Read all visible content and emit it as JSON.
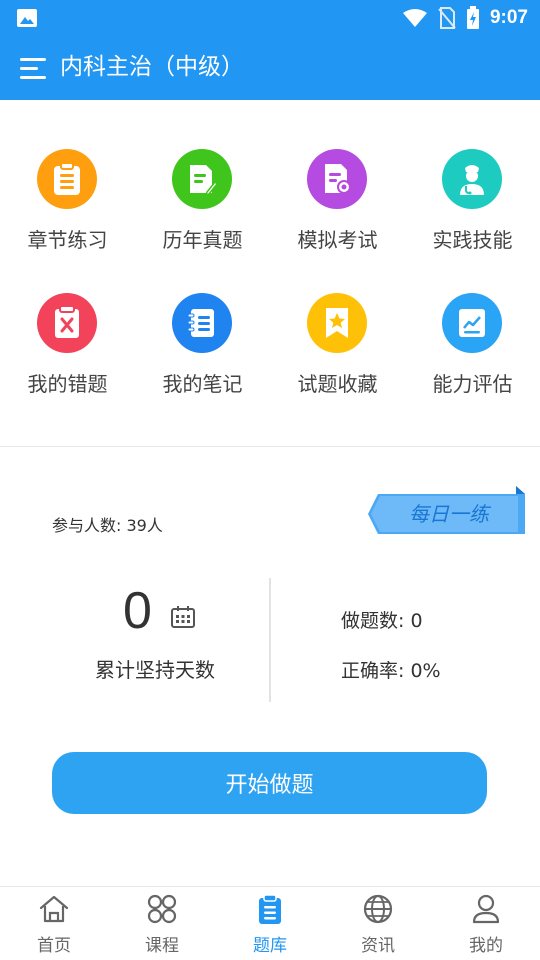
{
  "status_bar": {
    "time": "9:07",
    "icons": [
      "image-notification-icon",
      "wifi-icon",
      "no-sim-icon",
      "battery-charging-icon"
    ]
  },
  "header": {
    "title": "内科主治（中级）",
    "menu_icon": "menu-icon"
  },
  "features": [
    {
      "label": "章节练习",
      "icon": "clipboard-list-icon",
      "color": "#ff9f0f"
    },
    {
      "label": "历年真题",
      "icon": "document-edit-icon",
      "color": "#3fc51c"
    },
    {
      "label": "模拟考试",
      "icon": "certificate-document-icon",
      "color": "#b54be0"
    },
    {
      "label": "实践技能",
      "icon": "doctor-icon",
      "color": "#1ecbc0"
    },
    {
      "label": "我的错题",
      "icon": "wrong-answer-icon",
      "color": "#f2435a"
    },
    {
      "label": "我的笔记",
      "icon": "notebook-icon",
      "color": "#1f84f0"
    },
    {
      "label": "试题收藏",
      "icon": "bookmark-star-icon",
      "color": "#ffc107"
    },
    {
      "label": "能力评估",
      "icon": "trend-chart-icon",
      "color": "#2aa4f4"
    }
  ],
  "stats": {
    "participants": "参与人数: 39人",
    "daily_practice": "每日一练",
    "days_value": "0",
    "days_label": "累计坚持天数",
    "question_count": "做题数: 0",
    "accuracy": "正确率: 0%"
  },
  "start_button": "开始做题",
  "bottom_nav": [
    {
      "label": "首页",
      "icon": "home-icon",
      "active": false
    },
    {
      "label": "课程",
      "icon": "courses-grid-icon",
      "active": false
    },
    {
      "label": "题库",
      "icon": "question-bank-icon",
      "active": true
    },
    {
      "label": "资讯",
      "icon": "globe-icon",
      "active": false
    },
    {
      "label": "我的",
      "icon": "user-icon",
      "active": false
    }
  ],
  "colors": {
    "primary": "#2196f3",
    "button": "#2ea3f2",
    "daily_tag": "#4aa8f5"
  }
}
